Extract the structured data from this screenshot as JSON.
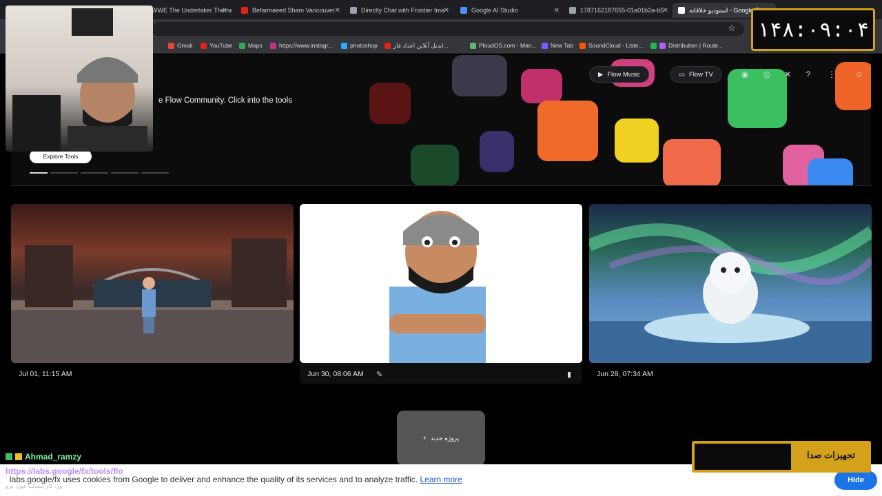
{
  "browser": {
    "tabs": [
      {
        "title": "WWE The Undertaker Theme S",
        "color": "#e62117"
      },
      {
        "title": "Befarmaeed Sham Vancouver",
        "color": "#e62117"
      },
      {
        "title": "Directly Chat with Frontier Ima",
        "color": "#9aa0a6"
      },
      {
        "title": "Google AI Studio",
        "color": "#4f8ef7"
      },
      {
        "title": "1787162187655-01a01b2a-b5",
        "color": "#9aa0a6"
      },
      {
        "title": "استودیو خلاقانه - Google F",
        "color": "#ffffff"
      }
    ],
    "bookmarks": [
      {
        "label": "Gmail",
        "color": "#ea4335"
      },
      {
        "label": "YouTube",
        "color": "#e62117"
      },
      {
        "label": "Maps",
        "color": "#34a853"
      },
      {
        "label": "https://www.instagr...",
        "color": "#c13584"
      },
      {
        "label": "photoshop",
        "color": "#31a8ff"
      },
      {
        "label": "ایدیل آنلاین اعداد قار...",
        "color": "#e62117"
      },
      {
        "label": "PloudOS.com - Man...",
        "color": "#5bb974"
      },
      {
        "label": "New Tab",
        "color": "#7b5cff"
      },
      {
        "label": "SoundCloud - Liste...",
        "color": "#ff5500"
      },
      {
        "label": "Distribution | Route...",
        "color": "#b65cff"
      }
    ]
  },
  "header": {
    "subtitle": "e Flow Community. Click into the tools",
    "explore_label": "Explore Tools",
    "flow_music_label": "Flow Music",
    "flow_tv_label": "Flow TV"
  },
  "projects": [
    {
      "date": "Jul 01, 11:15 AM"
    },
    {
      "date": "Jun 30, 08:06 AM"
    },
    {
      "date": "Jun 28, 07:34 AM"
    }
  ],
  "new_project_label": "پروژه جدید",
  "overlay": {
    "clock": "۱۴۸:۰۹:۰۴",
    "chat_user": "Ahmad_ramzy",
    "chat_url": "https://labs.google/fx/tools/flo",
    "chat_sub": "ون کار نمیکنه فون پرو",
    "audio_label": "تجهیزات صدا"
  },
  "cookie": {
    "text": "labs.google/fx uses cookies from Google to deliver and enhance the quality of its services and to analyze traffic.",
    "link": "Learn more",
    "hide_label": "Hide"
  }
}
